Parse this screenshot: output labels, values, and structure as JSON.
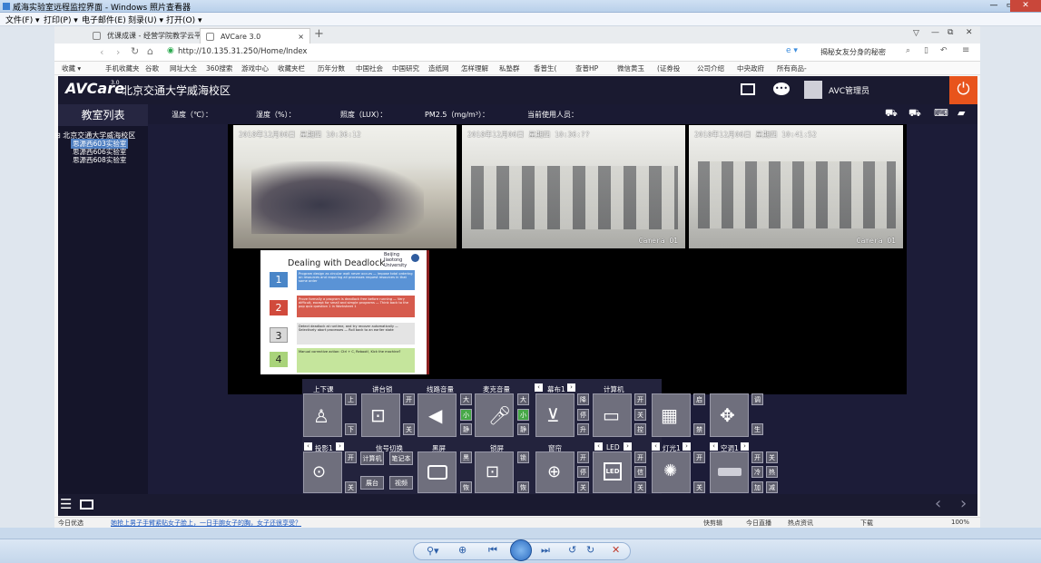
{
  "window": {
    "title": "威海实验室远程监控界面 - Windows 照片查看器"
  },
  "viewer_menu": [
    {
      "label": "文件(F) ▾"
    },
    {
      "label": "打印(P) ▾"
    },
    {
      "label": "电子邮件(E)"
    },
    {
      "label": "刻录(U) ▾"
    },
    {
      "label": "打开(O) ▾"
    }
  ],
  "browser": {
    "tabs": [
      {
        "label": "优课成课 - 经营学院教学云平台"
      },
      {
        "label": "AVCare 3.0"
      }
    ],
    "url": "http://10.135.31.250/Home/Index",
    "search_text": "揭秘女友分身的秘密",
    "bookmarks": [
      "收藏 ▾",
      "手机收藏夹",
      "谷歌",
      "网址大全",
      "360搜索",
      "游戏中心",
      "收藏夹栏",
      "历年分数",
      "中国社会",
      "中国研究",
      "造纸网",
      "怎样理解",
      "私塾群",
      "香普生(",
      "查普HP",
      "微信黄玉",
      "(证券投",
      "公司介绍",
      "中央政府",
      "所有商品-"
    ]
  },
  "app": {
    "logo": "AVCare",
    "logo_version": "3.0",
    "school": "北京交通大学威海校区",
    "user": "AVC管理员",
    "sidebar_title": "教室列表",
    "tree_root": "北京交通大学威海校区",
    "rooms": [
      "思源西603实验室",
      "思源西606实验室",
      "思源西608实验室"
    ],
    "stats": [
      {
        "label": "温度（℃）："
      },
      {
        "label": "湿度（%）："
      },
      {
        "label": "照度（LUX）："
      },
      {
        "label": "PM2.5（mg/m³）："
      },
      {
        "label": "当前使用人员："
      }
    ],
    "cameras": [
      {
        "time": "2018年12月06日 星期四 10:36:12",
        "label": ""
      },
      {
        "time": "2018年12月06日 星期四 10:36:??",
        "label": "Camera 01"
      },
      {
        "time": "2018年12月06日 星期四 10:41:52",
        "label": "Camera 01"
      }
    ],
    "slide": {
      "title": "Dealing with Deadlock",
      "uni_logo": "Beijing Jiaotong University",
      "items": [
        {
          "num": "1",
          "text": "Program design as circular wait never occurs — impose total ordering on resources and requiring all processes request resources in that same order"
        },
        {
          "num": "2",
          "text": "Prove formally a program is deadlock free before running — Very difficult, except for small and simple programs — Think back to the pop quiz question 1 in Worksheet 1"
        },
        {
          "num": "3",
          "text": "Detect deadlock at runtime, and try recover automatically — Selectively abort processes — Roll back to an earlier state"
        },
        {
          "num": "4",
          "text": "Manual corrective action: Ctrl + C, Reboot!, Kick the machine?"
        }
      ]
    },
    "controls_row1": [
      {
        "label": "上下课",
        "buttons": [
          "上",
          "下"
        ]
      },
      {
        "label": "讲台锁",
        "buttons": [
          "开",
          "关"
        ]
      },
      {
        "label": "线路音量",
        "buttons": [
          "大",
          "小",
          "静"
        ]
      },
      {
        "label": "麦克音量",
        "buttons": [
          "大",
          "小",
          "静"
        ]
      },
      {
        "label": "幕布1",
        "buttons": [
          "降",
          "停",
          "升"
        ]
      },
      {
        "label": "计算机",
        "buttons": [
          "开",
          "关",
          "控"
        ]
      },
      {
        "label": "",
        "buttons": [
          "启",
          "禁"
        ]
      },
      {
        "label": "",
        "buttons": [
          "调",
          "生"
        ]
      }
    ],
    "controls_row2": [
      {
        "label": "投影1",
        "buttons": [
          "开",
          "关"
        ]
      },
      {
        "label": "信号切换",
        "buttons": [
          "计算机",
          "笔记本",
          "展台",
          "视频"
        ]
      },
      {
        "label": "黑屏",
        "buttons": [
          "黑",
          "恢"
        ]
      },
      {
        "label": "锁屏",
        "buttons": [
          "锁",
          "恢"
        ]
      },
      {
        "label": "窗帘",
        "buttons": [
          "开",
          "停",
          "关"
        ]
      },
      {
        "label": "LED",
        "buttons": [
          "开",
          "信",
          "关"
        ]
      },
      {
        "label": "灯光1",
        "buttons": [
          "开",
          "关"
        ]
      },
      {
        "label": "空调1",
        "buttons": [
          "开",
          "关",
          "冷",
          "热",
          "加",
          "减"
        ]
      }
    ]
  },
  "status": {
    "left": "今日优选",
    "news": "她抢上男子手臂紧贴女子脸上，一日手腕女子的胸，女子还很享受？",
    "right": [
      "快剪辑",
      "今日直播",
      "热点资讯",
      "下载",
      "100%"
    ]
  }
}
